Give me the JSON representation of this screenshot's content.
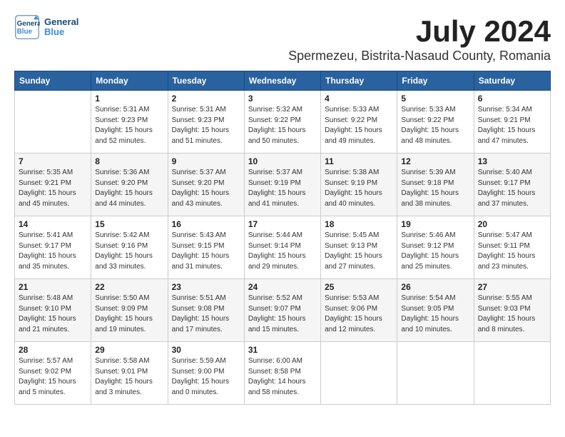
{
  "header": {
    "month": "July 2024",
    "location": "Spermezeu, Bistrita-Nasaud County, Romania",
    "logo_line1": "General",
    "logo_line2": "Blue"
  },
  "weekdays": [
    "Sunday",
    "Monday",
    "Tuesday",
    "Wednesday",
    "Thursday",
    "Friday",
    "Saturday"
  ],
  "weeks": [
    [
      {
        "day": "",
        "info": ""
      },
      {
        "day": "1",
        "info": "Sunrise: 5:31 AM\nSunset: 9:23 PM\nDaylight: 15 hours\nand 52 minutes."
      },
      {
        "day": "2",
        "info": "Sunrise: 5:31 AM\nSunset: 9:23 PM\nDaylight: 15 hours\nand 51 minutes."
      },
      {
        "day": "3",
        "info": "Sunrise: 5:32 AM\nSunset: 9:22 PM\nDaylight: 15 hours\nand 50 minutes."
      },
      {
        "day": "4",
        "info": "Sunrise: 5:33 AM\nSunset: 9:22 PM\nDaylight: 15 hours\nand 49 minutes."
      },
      {
        "day": "5",
        "info": "Sunrise: 5:33 AM\nSunset: 9:22 PM\nDaylight: 15 hours\nand 48 minutes."
      },
      {
        "day": "6",
        "info": "Sunrise: 5:34 AM\nSunset: 9:21 PM\nDaylight: 15 hours\nand 47 minutes."
      }
    ],
    [
      {
        "day": "7",
        "info": "Sunrise: 5:35 AM\nSunset: 9:21 PM\nDaylight: 15 hours\nand 45 minutes."
      },
      {
        "day": "8",
        "info": "Sunrise: 5:36 AM\nSunset: 9:20 PM\nDaylight: 15 hours\nand 44 minutes."
      },
      {
        "day": "9",
        "info": "Sunrise: 5:37 AM\nSunset: 9:20 PM\nDaylight: 15 hours\nand 43 minutes."
      },
      {
        "day": "10",
        "info": "Sunrise: 5:37 AM\nSunset: 9:19 PM\nDaylight: 15 hours\nand 41 minutes."
      },
      {
        "day": "11",
        "info": "Sunrise: 5:38 AM\nSunset: 9:19 PM\nDaylight: 15 hours\nand 40 minutes."
      },
      {
        "day": "12",
        "info": "Sunrise: 5:39 AM\nSunset: 9:18 PM\nDaylight: 15 hours\nand 38 minutes."
      },
      {
        "day": "13",
        "info": "Sunrise: 5:40 AM\nSunset: 9:17 PM\nDaylight: 15 hours\nand 37 minutes."
      }
    ],
    [
      {
        "day": "14",
        "info": "Sunrise: 5:41 AM\nSunset: 9:17 PM\nDaylight: 15 hours\nand 35 minutes."
      },
      {
        "day": "15",
        "info": "Sunrise: 5:42 AM\nSunset: 9:16 PM\nDaylight: 15 hours\nand 33 minutes."
      },
      {
        "day": "16",
        "info": "Sunrise: 5:43 AM\nSunset: 9:15 PM\nDaylight: 15 hours\nand 31 minutes."
      },
      {
        "day": "17",
        "info": "Sunrise: 5:44 AM\nSunset: 9:14 PM\nDaylight: 15 hours\nand 29 minutes."
      },
      {
        "day": "18",
        "info": "Sunrise: 5:45 AM\nSunset: 9:13 PM\nDaylight: 15 hours\nand 27 minutes."
      },
      {
        "day": "19",
        "info": "Sunrise: 5:46 AM\nSunset: 9:12 PM\nDaylight: 15 hours\nand 25 minutes."
      },
      {
        "day": "20",
        "info": "Sunrise: 5:47 AM\nSunset: 9:11 PM\nDaylight: 15 hours\nand 23 minutes."
      }
    ],
    [
      {
        "day": "21",
        "info": "Sunrise: 5:48 AM\nSunset: 9:10 PM\nDaylight: 15 hours\nand 21 minutes."
      },
      {
        "day": "22",
        "info": "Sunrise: 5:50 AM\nSunset: 9:09 PM\nDaylight: 15 hours\nand 19 minutes."
      },
      {
        "day": "23",
        "info": "Sunrise: 5:51 AM\nSunset: 9:08 PM\nDaylight: 15 hours\nand 17 minutes."
      },
      {
        "day": "24",
        "info": "Sunrise: 5:52 AM\nSunset: 9:07 PM\nDaylight: 15 hours\nand 15 minutes."
      },
      {
        "day": "25",
        "info": "Sunrise: 5:53 AM\nSunset: 9:06 PM\nDaylight: 15 hours\nand 12 minutes."
      },
      {
        "day": "26",
        "info": "Sunrise: 5:54 AM\nSunset: 9:05 PM\nDaylight: 15 hours\nand 10 minutes."
      },
      {
        "day": "27",
        "info": "Sunrise: 5:55 AM\nSunset: 9:03 PM\nDaylight: 15 hours\nand 8 minutes."
      }
    ],
    [
      {
        "day": "28",
        "info": "Sunrise: 5:57 AM\nSunset: 9:02 PM\nDaylight: 15 hours\nand 5 minutes."
      },
      {
        "day": "29",
        "info": "Sunrise: 5:58 AM\nSunset: 9:01 PM\nDaylight: 15 hours\nand 3 minutes."
      },
      {
        "day": "30",
        "info": "Sunrise: 5:59 AM\nSunset: 9:00 PM\nDaylight: 15 hours\nand 0 minutes."
      },
      {
        "day": "31",
        "info": "Sunrise: 6:00 AM\nSunset: 8:58 PM\nDaylight: 14 hours\nand 58 minutes."
      },
      {
        "day": "",
        "info": ""
      },
      {
        "day": "",
        "info": ""
      },
      {
        "day": "",
        "info": ""
      }
    ]
  ]
}
